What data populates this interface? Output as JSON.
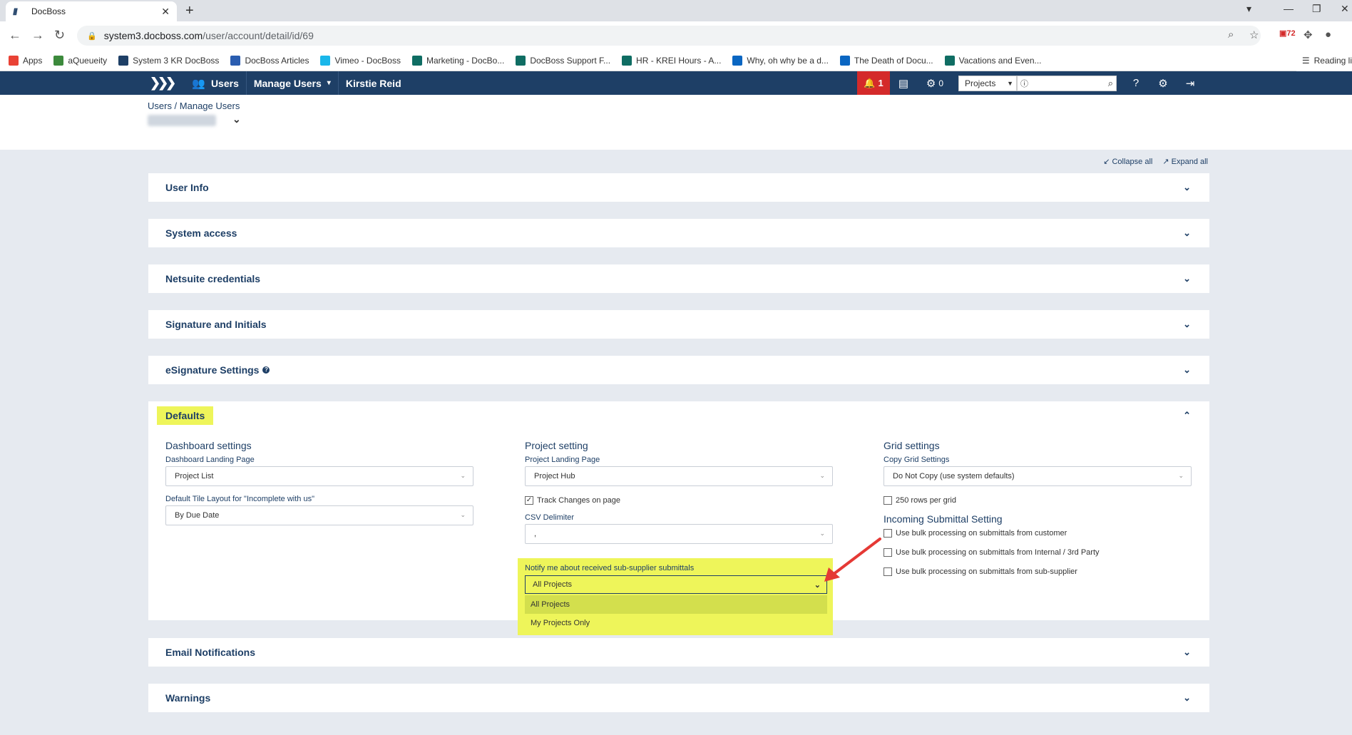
{
  "browser": {
    "tab_title": "DocBoss",
    "url_host": "system3.docboss.com",
    "url_path": "/user/account/detail/id/69",
    "extension_badge": "72",
    "bookmarks": [
      {
        "label": "Apps",
        "color": "#e94235"
      },
      {
        "label": "aQueueity",
        "color": "#3c8a3c"
      },
      {
        "label": "System 3 KR DocBoss",
        "color": "#1e3f66"
      },
      {
        "label": "DocBoss Articles",
        "color": "#2a5db0"
      },
      {
        "label": "Vimeo - DocBoss",
        "color": "#1ab7ea"
      },
      {
        "label": "Marketing - DocBo...",
        "color": "#0f6d63"
      },
      {
        "label": "DocBoss Support F...",
        "color": "#0f6d63"
      },
      {
        "label": "HR - KREI Hours - A...",
        "color": "#0f6d63"
      },
      {
        "label": "Why, oh why be a d...",
        "color": "#0a66c2"
      },
      {
        "label": "The Death of Docu...",
        "color": "#0a66c2"
      },
      {
        "label": "Vacations and Even...",
        "color": "#0f6d63"
      }
    ],
    "reading_list": "Reading li"
  },
  "header": {
    "crumbs": [
      "Users",
      "Manage Users",
      "Kirstie Reid"
    ],
    "alert_count": "1",
    "gear_count": "0",
    "project_select": "Projects"
  },
  "page": {
    "breadcrumb": "Users / Manage Users",
    "collapse_all": "Collapse all",
    "expand_all": "Expand all"
  },
  "panels": {
    "user_info": "User Info",
    "system_access": "System access",
    "netsuite": "Netsuite credentials",
    "signature": "Signature and Initials",
    "esignature": "eSignature Settings",
    "defaults": "Defaults",
    "email": "Email Notifications",
    "warnings": "Warnings"
  },
  "defaults": {
    "dashboard": {
      "heading": "Dashboard settings",
      "landing_label": "Dashboard Landing Page",
      "landing_value": "Project List",
      "tile_label": "Default Tile Layout for \"Incomplete with us\"",
      "tile_value": "By Due Date"
    },
    "project": {
      "heading": "Project setting",
      "landing_label": "Project Landing Page",
      "landing_value": "Project Hub",
      "track_changes": "Track Changes on page",
      "csv_label": "CSV Delimiter",
      "csv_value": ",",
      "notify_label": "Notify me about received sub-supplier submittals",
      "notify_value": "All Projects",
      "notify_options": [
        "All Projects",
        "My Projects Only"
      ]
    },
    "grid": {
      "heading": "Grid settings",
      "copy_label": "Copy Grid Settings",
      "copy_value": "Do Not Copy (use system defaults)",
      "rows_per_grid": "250 rows per grid",
      "incoming_heading": "Incoming Submittal Setting",
      "bulk_customer": "Use bulk processing on submittals from customer",
      "bulk_internal": "Use bulk processing on submittals from Internal / 3rd Party",
      "bulk_subsupplier": "Use bulk processing on submittals from sub-supplier"
    }
  },
  "colors": {
    "brand": "#1e3f66",
    "alert": "#d42a2a",
    "highlight": "#eef55a",
    "arrow": "#e53935"
  }
}
